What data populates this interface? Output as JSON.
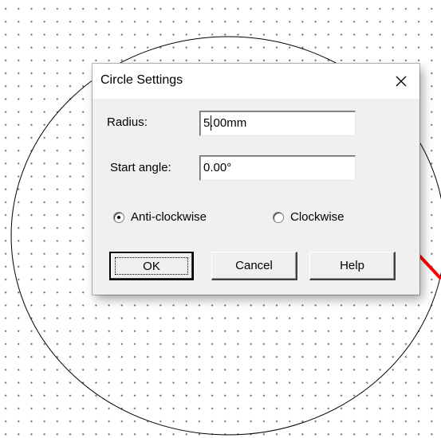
{
  "dialog": {
    "title": "Circle Settings",
    "close_label": "×",
    "radius_label": "Radius:",
    "radius_value": "5.00mm",
    "start_angle_label": "Start angle:",
    "start_angle_value": "0.00°",
    "direction_options": [
      {
        "label": "Anti-clockwise",
        "selected": true
      },
      {
        "label": "Clockwise",
        "selected": false
      }
    ],
    "buttons": {
      "ok": "OK",
      "cancel": "Cancel",
      "help": "Help"
    }
  },
  "icons": {
    "close": "close-icon",
    "annotation": "red-arrow-icon"
  },
  "colors": {
    "dialog_bg": "#f0f0f0",
    "grid_dot": "#6b6b6b",
    "annotation_arrow": "#ff0000"
  }
}
